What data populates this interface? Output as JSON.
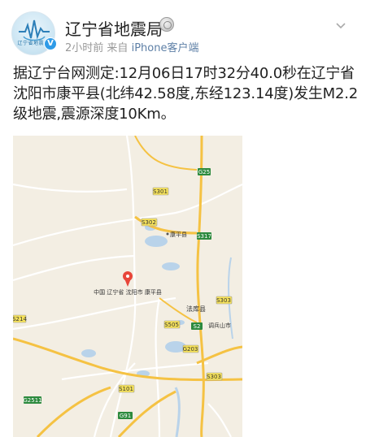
{
  "account": {
    "name": "辽宁省地震局",
    "avatar_caption": "辽宁省地震局",
    "verified": "V",
    "time": "2小时前",
    "source_prefix": "来自",
    "client": "iPhone客户端"
  },
  "post": {
    "text": "据辽宁台网测定:12月06日17时32分40.0秒在辽宁省沈阳市康平县(北纬42.58度,东经123.14度)发生M2.2级地震,震源深度10Km。"
  },
  "map": {
    "pin_label": "中国 辽宁省 沈阳市 康平县",
    "places": {
      "kangping": "康平县",
      "faku": "法库县",
      "tiaobing": "调兵山市"
    },
    "roads": {
      "g25": "G25",
      "s301": "S301",
      "s302": "S302",
      "s317": "S317",
      "s303_a": "S303",
      "s2": "S2",
      "s505": "S505",
      "s214": "S214",
      "g203": "G203",
      "s303_b": "S303",
      "g2511": "G2511",
      "s101": "S101",
      "g91": "G91"
    },
    "colors": {
      "land": "#f3eee3",
      "water": "#b9d3ea",
      "highway": "#f5c243",
      "road": "#ffffff",
      "pin": "#e8463a"
    }
  }
}
